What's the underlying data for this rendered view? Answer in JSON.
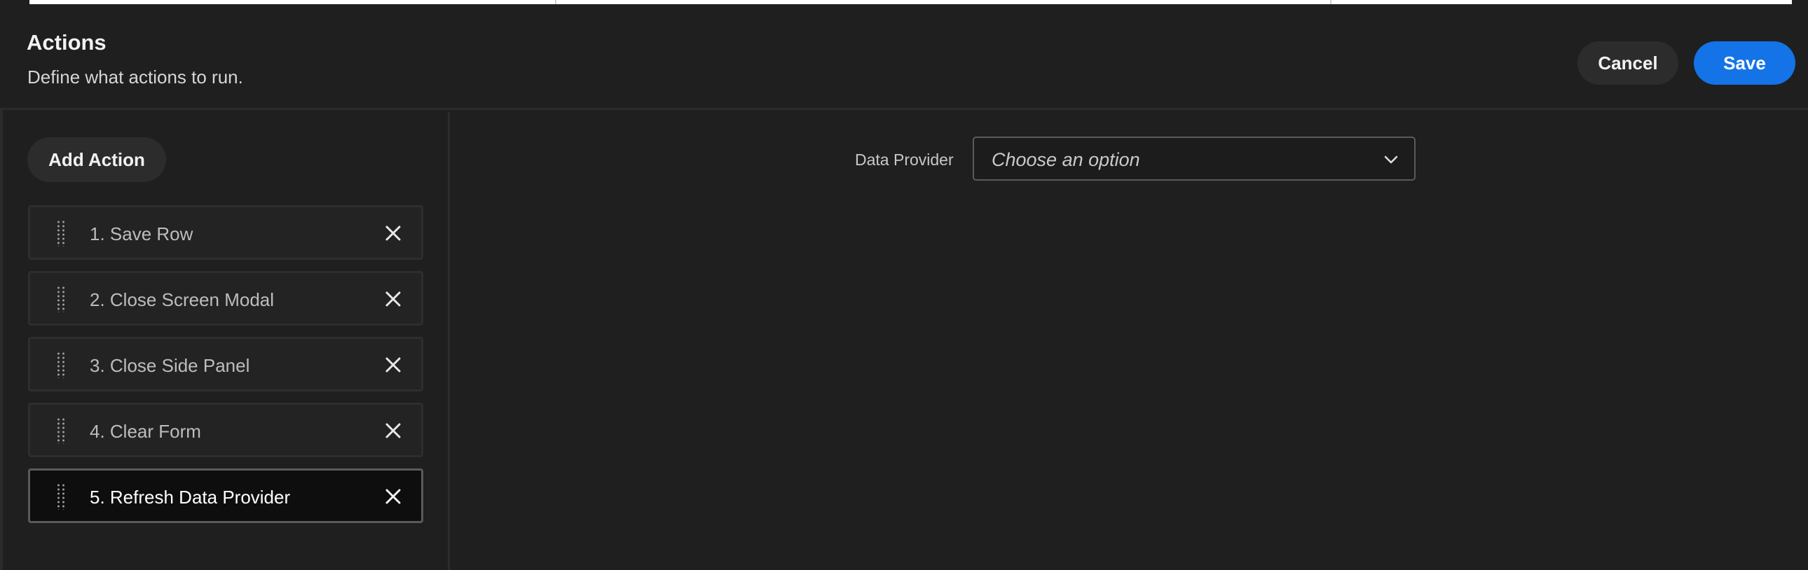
{
  "header": {
    "title": "Actions",
    "subtitle": "Define what actions to run.",
    "cancel_label": "Cancel",
    "save_label": "Save"
  },
  "sidebar": {
    "add_action_label": "Add Action",
    "items": [
      {
        "label": "1. Save Row",
        "selected": false
      },
      {
        "label": "2. Close Screen Modal",
        "selected": false
      },
      {
        "label": "3. Close Side Panel",
        "selected": false
      },
      {
        "label": "4. Clear Form",
        "selected": false
      },
      {
        "label": "5. Refresh Data Provider",
        "selected": true
      }
    ]
  },
  "main": {
    "data_provider_label": "Data Provider",
    "data_provider_placeholder": "Choose an option"
  },
  "colors": {
    "background": "#1f1f1f",
    "accent": "#1473e6",
    "selected_item_bg": "#0e0e0e"
  }
}
